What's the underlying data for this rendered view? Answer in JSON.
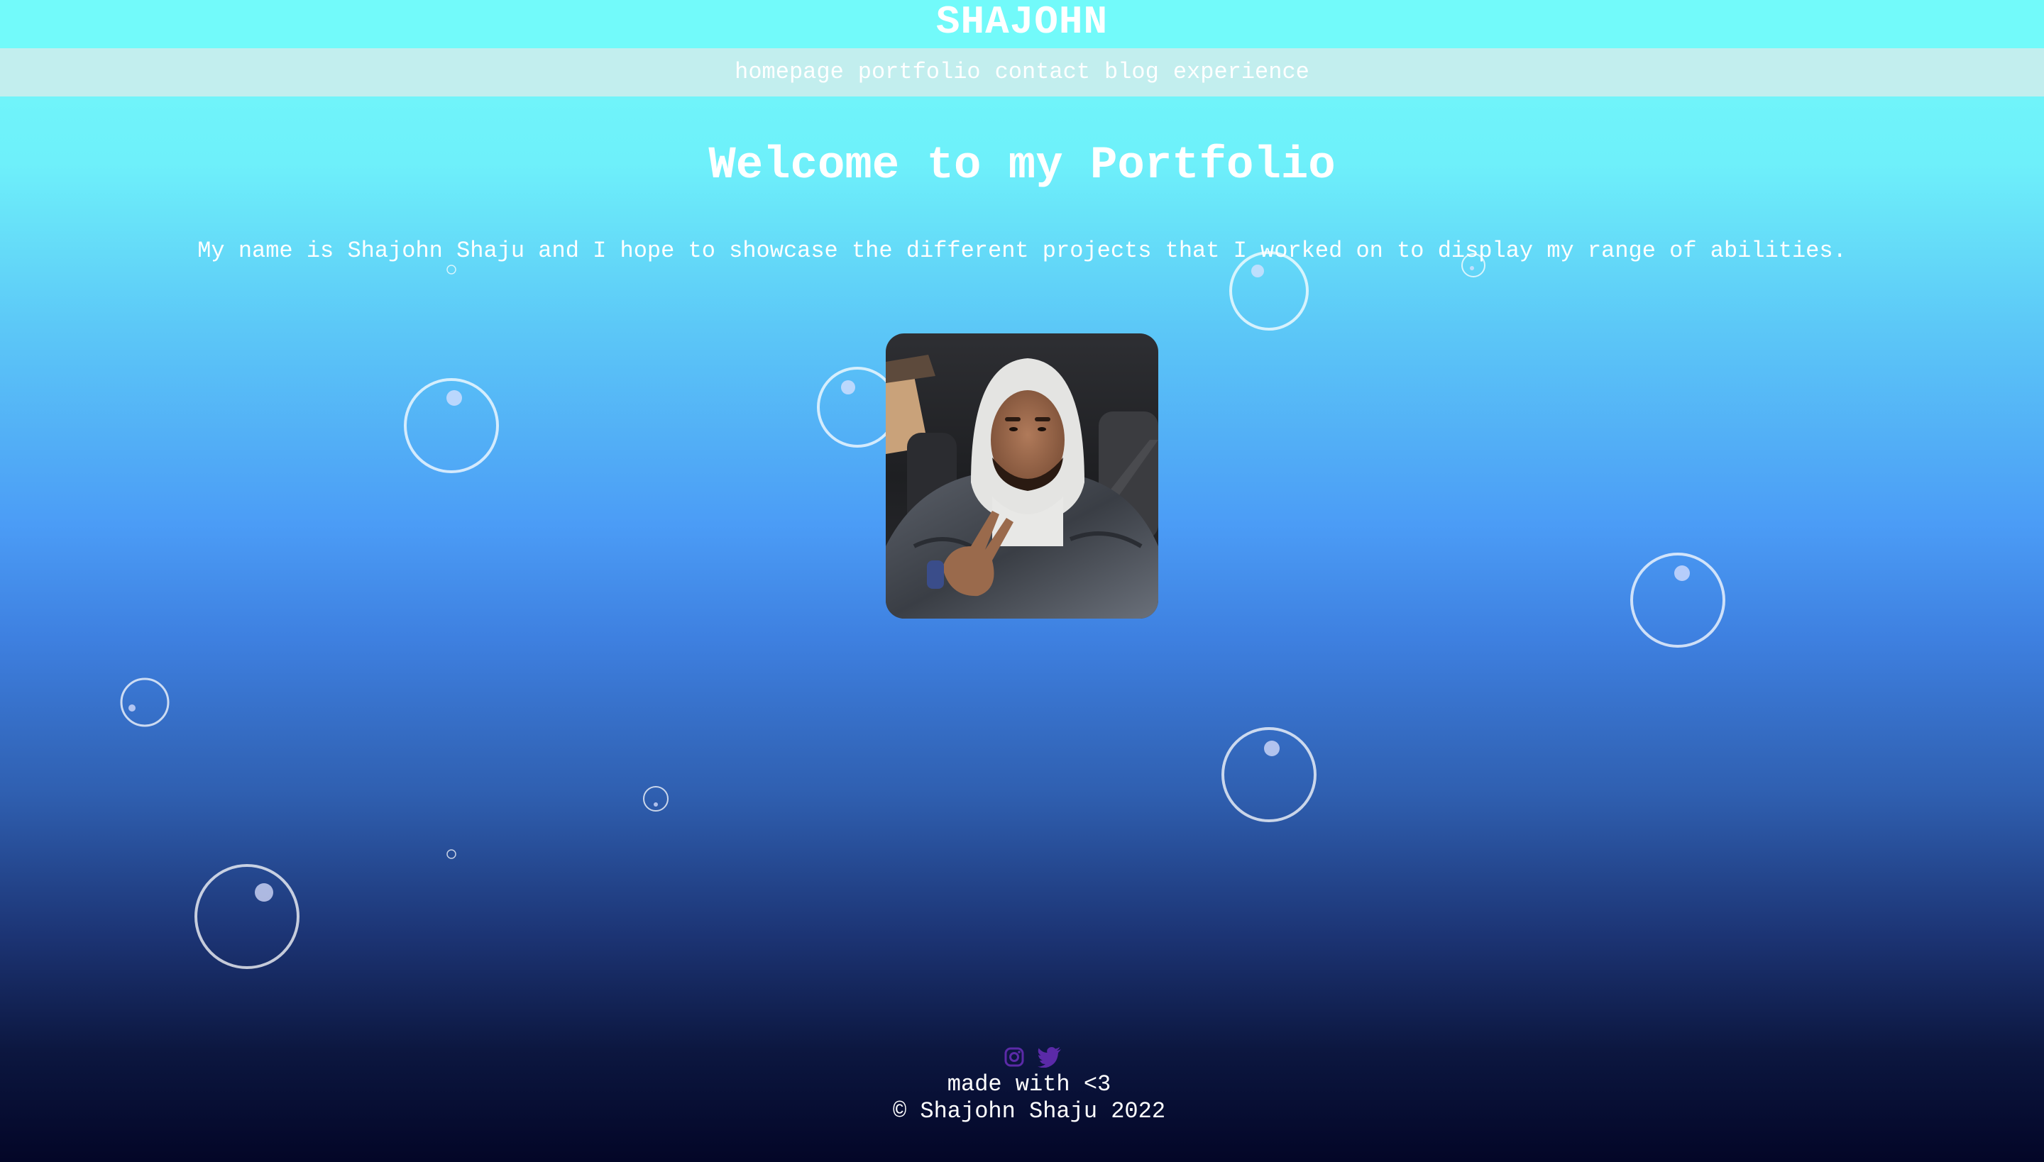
{
  "header": {
    "site_title": "SHAJOHN"
  },
  "nav": {
    "items": [
      "homepage",
      "portfolio",
      "contact",
      "blog",
      "experience"
    ]
  },
  "main": {
    "title": "Welcome to my Portfolio",
    "intro": "My name is Shajohn Shaju and I hope to showcase the different projects that I worked on to display my range of abilities.",
    "portrait_icon": "profile-photo"
  },
  "footer": {
    "social_icons": [
      "instagram-icon",
      "twitter-icon"
    ],
    "made_with": "made with <3",
    "copyright": "© Shajohn Shaju 2022"
  },
  "colors": {
    "header_bg": "#72fafa",
    "nav_bg": "#c2eeee",
    "social_icon": "#5b2aa8"
  }
}
